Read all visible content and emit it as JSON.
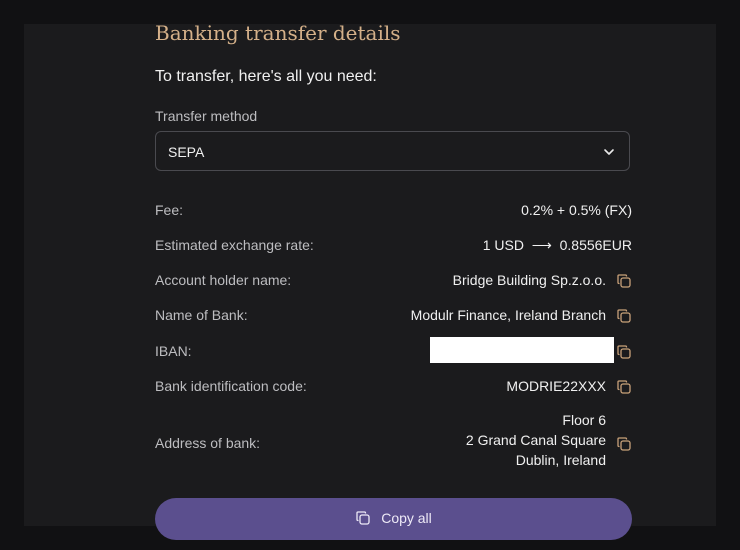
{
  "page": {
    "title": "Banking transfer details",
    "subtitle": "To transfer, here's all you need:"
  },
  "method": {
    "label": "Transfer method",
    "value": "SEPA"
  },
  "details": {
    "fee": {
      "label": "Fee:",
      "value": "0.2% + 0.5% (FX)"
    },
    "rate": {
      "label": "Estimated exchange rate:",
      "value": "1 USD  ⟶  0.8556EUR"
    },
    "holder": {
      "label": "Account holder name:",
      "value": "Bridge Building Sp.z.o.o."
    },
    "bank": {
      "label": "Name of Bank:",
      "value": "Modulr Finance, Ireland Branch"
    },
    "iban": {
      "label": "IBAN:",
      "value": ""
    },
    "bic": {
      "label": "Bank identification code:",
      "value": "MODRIE22XXX"
    },
    "address": {
      "label": "Address of bank:",
      "lines": [
        "Floor 6",
        "2 Grand Canal Square",
        "Dublin, Ireland"
      ]
    }
  },
  "copy_all": {
    "label": "Copy all"
  },
  "icons": {
    "copy": "copy-icon",
    "chevron": "chevron-down-icon"
  },
  "colors": {
    "accent": "#5b4f8e",
    "title": "#d4b089",
    "copy_icon": "#c9a27a"
  }
}
